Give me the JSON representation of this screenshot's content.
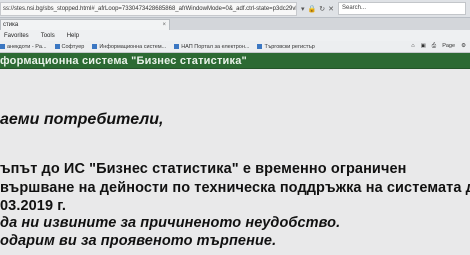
{
  "browser": {
    "url": "ss://stes.nsi.bg/sbs_stopped.html#_afrLoop=7330473428685868_afrWindowMode=0&_adf.ctrl-state=p3dc29vh_4",
    "search_placeholder": "Search...",
    "tab_title": "стика",
    "menu": [
      "Favorites",
      "Tools",
      "Help"
    ],
    "favorites": [
      "анекдоти - Pa...",
      "Софтуер",
      "Информационна систем...",
      "НАП Портал за електрон...",
      "Търговски регистър"
    ],
    "page_menu": "Page",
    "icon_names": [
      "refresh-icon",
      "stop-icon",
      "close-icon",
      "home-icon",
      "feed-icon",
      "print-icon",
      "settings-icon"
    ]
  },
  "page": {
    "header_title": "формационна система \"Бизнес статистика\"",
    "greeting": "аеми потребители,",
    "line1": "ъпът до ИС \"Бизнес статистика\" е временно ограничен",
    "line2": "вършване на дейности по техническа поддръжка на системата до",
    "line3": "03.2019 г.",
    "line4": "да ни извините за причиненото неудобство.",
    "line5": "одарим ви за проявеното търпение."
  },
  "colors": {
    "header_bg": "#2c6a33",
    "header_text": "#e9f2e9",
    "page_bg": "#e9e9ea"
  }
}
